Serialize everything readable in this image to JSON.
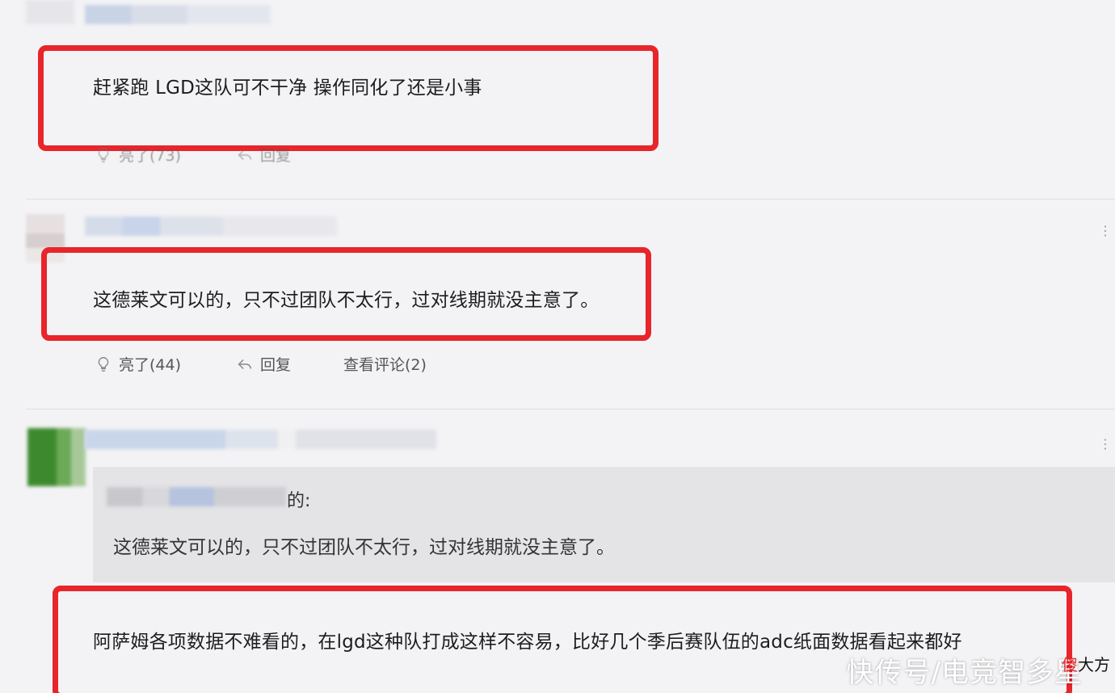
{
  "comments": [
    {
      "text": "赶紧跑 LGD这队可不干净 操作同化了还是小事",
      "like_label": "亮了(73)",
      "reply_label": "回复"
    },
    {
      "text": "这德莱文可以的，只不过团队不太行，过对线期就没主意了。",
      "like_label": "亮了(44)",
      "reply_label": "回复",
      "view_comments_label": "查看评论(2)"
    },
    {
      "quote_author_suffix": "的:",
      "quote_text": "这德莱文可以的，只不过团队不太行，过对线期就没主意了。",
      "text": "阿萨姆各项数据不难看的，在lgd这种队打成这样不容易，比好几个季后赛队伍的adc纸面数据看起来都好"
    }
  ],
  "watermark": {
    "text": "快传号/电竞智多星",
    "badge_highlight": "傻",
    "badge_text": "大方"
  },
  "colors": {
    "highlight_border": "#e8252b",
    "background": "#f3f3f5",
    "quote_background": "#e4e4e6"
  }
}
